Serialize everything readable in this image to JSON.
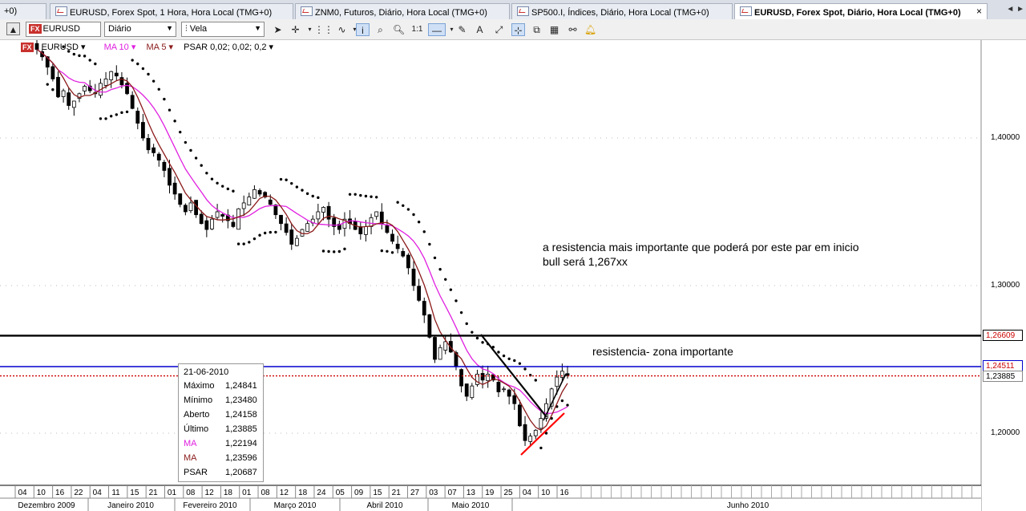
{
  "tabs": [
    {
      "label": "+0)"
    },
    {
      "label": "EURUSD, Forex Spot, 1 Hora, Hora Local (TMG+0)"
    },
    {
      "label": "ZNM0, Futuros, Diário, Hora Local (TMG+0)"
    },
    {
      "label": "SP500.I, Índices, Diário, Hora Local (TMG+0)"
    },
    {
      "label": "EURUSD, Forex Spot, Diário, Hora Local (TMG+0)"
    }
  ],
  "tab_close": "×",
  "tab_nav": "◄ ►",
  "toolbar": {
    "symbol_badge": "FX",
    "symbol_value": "EURUSD",
    "period_value": "Diário",
    "chart_type_value": "Vela",
    "one_to_one": "1:1"
  },
  "legend": {
    "symbol_badge": "FX",
    "symbol": "EURUSD ▾",
    "ma10": "MA 10 ▾",
    "ma5": "MA 5 ▾",
    "psar": "PSAR 0,02; 0,02; 0,2 ▾"
  },
  "tooltip": {
    "date": "21-06-2010",
    "rows": [
      {
        "label": "Máximo",
        "value": "1,24841",
        "color": "#000000"
      },
      {
        "label": "Mínimo",
        "value": "1,23480",
        "color": "#000000"
      },
      {
        "label": "Aberto",
        "value": "1,24158",
        "color": "#000000"
      },
      {
        "label": "Último",
        "value": "1,23885",
        "color": "#000000"
      },
      {
        "label": "MA",
        "value": "1,22194",
        "color": "#e020e0"
      },
      {
        "label": "MA",
        "value": "1,23596",
        "color": "#8b1a1a"
      },
      {
        "label": "PSAR",
        "value": "1,20687",
        "color": "#000000"
      }
    ]
  },
  "annotations": {
    "note1_line1": "a resistencia mais importante que poderá por este par em inicio",
    "note1_line2": "bull será 1,267xx",
    "note2": "resistencia- zona importante"
  },
  "price_labels": {
    "black_line": "1,26609",
    "blue_line": "1,24511",
    "last_price": "1,23885"
  },
  "colors": {
    "ma10": "#e020e0",
    "ma5": "#8b1a1a",
    "blue_line": "#0000cc",
    "red_dotted": "#cc0000",
    "trend_red": "#ff0000"
  },
  "chart_data": {
    "type": "candlestick",
    "symbol": "EURUSD",
    "period": "Diário",
    "y_ticks": [
      "1,40000",
      "1,30000",
      "1,20000"
    ],
    "y_tick_values": [
      1.4,
      1.3,
      1.2
    ],
    "ylim": [
      1.165,
      1.46
    ],
    "horizontal_lines": [
      {
        "value": 1.26609,
        "color": "#000000"
      },
      {
        "value": 1.24511,
        "color": "#0000cc"
      },
      {
        "value": 1.23885,
        "color": "#cc0000",
        "style": "dotted"
      }
    ],
    "x_day_ticks": [
      "04",
      "10",
      "16",
      "22",
      "04",
      "11",
      "15",
      "21",
      "01",
      "08",
      "12",
      "18",
      "01",
      "08",
      "12",
      "18",
      "24",
      "05",
      "09",
      "15",
      "21",
      "27",
      "03",
      "07",
      "13",
      "19",
      "25",
      "04",
      "10",
      "16"
    ],
    "x_month_labels": [
      "Dezembro 2009",
      "Janeiro 2010",
      "Fevereiro 2010",
      "Março 2010",
      "Abril 2010",
      "Maio 2010",
      "Junho 2010"
    ],
    "close_series": [
      1.46,
      1.455,
      1.448,
      1.44,
      1.428,
      1.432,
      1.422,
      1.425,
      1.43,
      1.435,
      1.432,
      1.43,
      1.437,
      1.44,
      1.445,
      1.442,
      1.436,
      1.43,
      1.42,
      1.41,
      1.4,
      1.392,
      1.39,
      1.385,
      1.378,
      1.368,
      1.362,
      1.355,
      1.35,
      1.356,
      1.348,
      1.342,
      1.338,
      1.345,
      1.35,
      1.347,
      1.344,
      1.34,
      1.352,
      1.356,
      1.36,
      1.365,
      1.362,
      1.36,
      1.355,
      1.348,
      1.342,
      1.336,
      1.328,
      1.332,
      1.338,
      1.342,
      1.345,
      1.35,
      1.353,
      1.345,
      1.34,
      1.338,
      1.345,
      1.342,
      1.338,
      1.335,
      1.34,
      1.346,
      1.35,
      1.342,
      1.336,
      1.33,
      1.325,
      1.32,
      1.312,
      1.3,
      1.29,
      1.28,
      1.265,
      1.25,
      1.258,
      1.262,
      1.255,
      1.245,
      1.232,
      1.225,
      1.232,
      1.24,
      1.236,
      1.24,
      1.236,
      1.228,
      1.23,
      1.225,
      1.22,
      1.205,
      1.195,
      1.198,
      1.202,
      1.21,
      1.22,
      1.23,
      1.238,
      1.242,
      1.239
    ]
  }
}
